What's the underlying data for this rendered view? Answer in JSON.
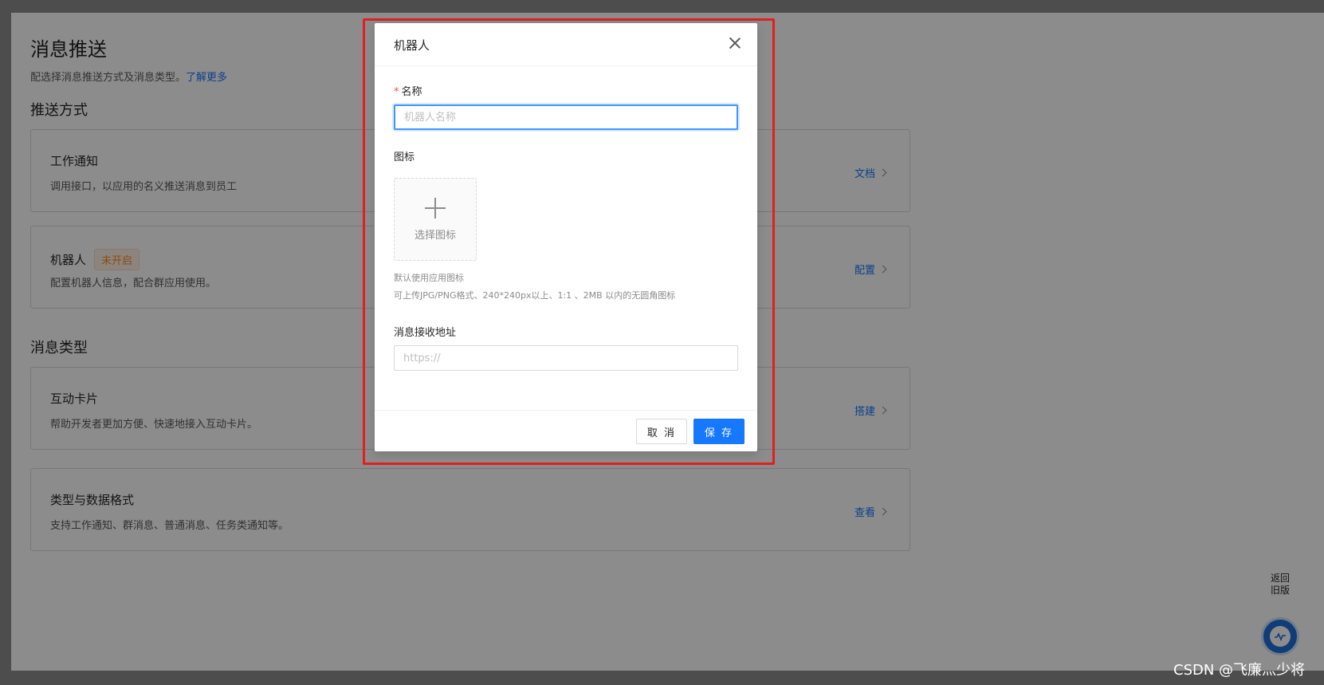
{
  "page": {
    "title": "消息推送",
    "desc": "配选择消息推送方式及消息类型。",
    "learn_more": "了解更多",
    "section_push": "推送方式",
    "section_types": "消息类型",
    "cards": [
      {
        "title": "工作通知",
        "desc": "调用接口，以应用的名义推送消息到员工",
        "action": "文档"
      },
      {
        "title": "机器人",
        "badge": "未开启",
        "desc": "配置机器人信息，配合群应用使用。",
        "action": "配置"
      },
      {
        "title": "互动卡片",
        "desc": "帮助开发者更加方便、快速地接入互动卡片。",
        "action": "搭建"
      },
      {
        "title": "类型与数据格式",
        "desc": "支持工作通知、群消息、普通消息、任务类通知等。",
        "action": "查看"
      }
    ]
  },
  "floating": {
    "back_old_line1": "返回",
    "back_old_line2": "旧版"
  },
  "watermark": "CSDN @飞廉灬少将",
  "modal": {
    "title": "机器人",
    "name_required_mark": "*",
    "name_label": "名称",
    "name_placeholder": "机器人名称",
    "name_value": "",
    "icon_label": "图标",
    "upload_text": "选择图标",
    "hint_1": "默认使用应用图标",
    "hint_2": "可上传JPG/PNG格式、240*240px以上、1:1 、2MB 以内的无圆角图标",
    "url_label": "消息接收地址",
    "url_placeholder": "https://",
    "url_value": "",
    "cancel_label": "取 消",
    "save_label": "保 存"
  },
  "colors": {
    "primary": "#1677ff",
    "highlight_frame": "#e02020",
    "badge_text": "#fa8c16"
  }
}
